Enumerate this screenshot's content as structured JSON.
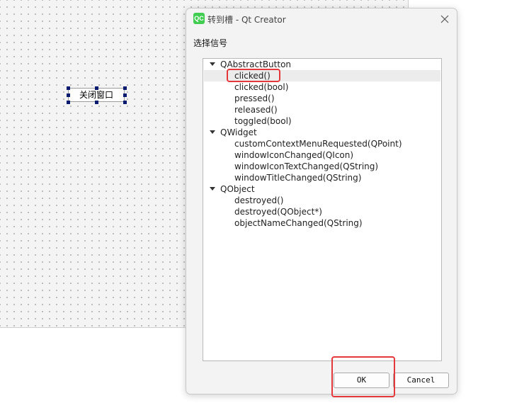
{
  "designer": {
    "button_text": "关闭窗口"
  },
  "dialog": {
    "icon_text": "QC",
    "title": "转到槽 - Qt Creator",
    "section_label": "选择信号",
    "groups": [
      {
        "name": "QAbstractButton",
        "signals": [
          "clicked()",
          "clicked(bool)",
          "pressed()",
          "released()",
          "toggled(bool)"
        ]
      },
      {
        "name": "QWidget",
        "signals": [
          "customContextMenuRequested(QPoint)",
          "windowIconChanged(QIcon)",
          "windowIconTextChanged(QString)",
          "windowTitleChanged(QString)"
        ]
      },
      {
        "name": "QObject",
        "signals": [
          "destroyed()",
          "destroyed(QObject*)",
          "objectNameChanged(QString)"
        ]
      }
    ],
    "selected_signal": "clicked()",
    "ok_label": "OK",
    "cancel_label": "Cancel"
  },
  "icons": {
    "close": "close-icon",
    "expand": "chevron-down-icon",
    "app": "qt-creator-icon"
  },
  "colors": {
    "highlight": "#e5383b",
    "selection": "#ececec",
    "qt_green": "#41cd52"
  }
}
